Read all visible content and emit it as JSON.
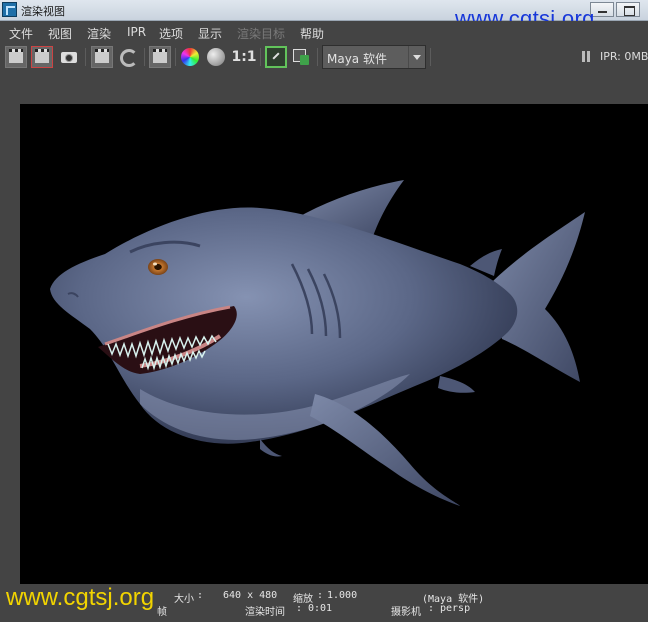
{
  "window": {
    "title": "渲染视图"
  },
  "watermarks": {
    "top": "www.cgtsj.org",
    "bottom": "www.cgtsj.org",
    "top_color": "#1737d9",
    "bottom_color": "#f2d400"
  },
  "menu": {
    "items": [
      "文件",
      "视图",
      "渲染",
      "IPR",
      "选项",
      "显示",
      "渲染目标",
      "帮助"
    ]
  },
  "toolbar": {
    "one_to_one": "1:1",
    "renderer": "Maya 软件",
    "ipr_status": "IPR: 0MB",
    "icons": [
      "render-clapper-icon",
      "redo-render-icon",
      "snapshot-camera-icon",
      "ipr-render-icon",
      "refresh-icon",
      "render-region-icon",
      "rgb-channel-icon",
      "alpha-channel-icon",
      "frame-image-icon",
      "remove-snapshot-icon",
      "pause-icon"
    ]
  },
  "status": {
    "size_label": "大小",
    "size_value": "640 x 480",
    "zoom_label": "缩放",
    "zoom_value": "1.000",
    "renderer_text": "(Maya 软件)",
    "frame_label": "帧",
    "render_time_label": "渲染时间",
    "render_time_value": "0:01",
    "camera_label": "摄影机",
    "camera_value": "persp"
  },
  "colors": {
    "panel_bg": "#444444",
    "viewport_bg": "#000000",
    "shark_body": "#5b6787",
    "shark_belly": "#8a96b4",
    "eye_iris": "#c4772f",
    "gum": "#c98585"
  }
}
